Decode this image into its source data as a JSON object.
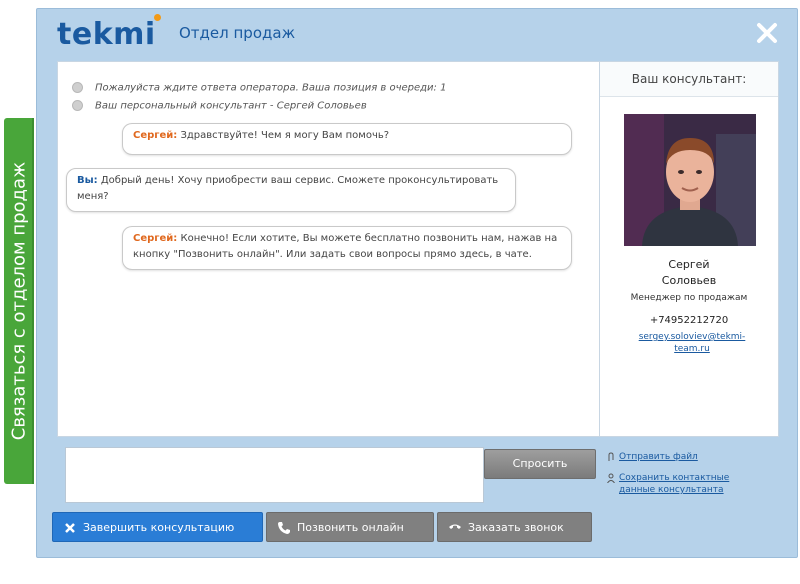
{
  "side_tab": {
    "label": "Связаться с отделом продаж"
  },
  "header": {
    "logo": "tekmi",
    "department": "Отдел продаж"
  },
  "chat": {
    "system_messages": [
      "Пожалуйста ждите ответа оператора. Ваша позиция в очереди: 1",
      "Ваш персональный консультант - Сергей Соловьев"
    ],
    "messages": [
      {
        "sender": "Сергей:",
        "text": "Здравствуйте! Чем я могу Вам помочь?"
      },
      {
        "sender": "Вы:",
        "text": "Добрый день! Хочу приобрести ваш сервис. Сможете проконсультировать меня?"
      },
      {
        "sender": "Сергей:",
        "text": "Конечно! Если хотите, Вы можете бесплатно позвонить нам, нажав на кнопку \"Позвонить онлайн\". Или задать свои вопросы прямо здесь, в чате."
      }
    ]
  },
  "consultant": {
    "heading": "Ваш консультант:",
    "first_name": "Сергей",
    "last_name": "Соловьев",
    "role": "Менеджер по продажам",
    "phone": "+74952212720",
    "email_line1": "sergey.soloviev@tekmi-",
    "email_line2": "team.ru"
  },
  "composer": {
    "send_label": "Спросить"
  },
  "links": {
    "send_file": "Отправить файл",
    "save_contacts_line1": "Сохранить контактные",
    "save_contacts_line2": "данные консультанта"
  },
  "footer": {
    "end_label": "Завершить консультацию",
    "call_online_label": "Позвонить онлайн",
    "order_call_label": "Заказать звонок"
  },
  "colors": {
    "brand_blue": "#1a5aa0",
    "accent_orange": "#f29a16",
    "green_tab": "#49a63a",
    "window_bg": "#b6d2ea",
    "primary_button": "#2a7dd6",
    "secondary_button": "#808080"
  }
}
